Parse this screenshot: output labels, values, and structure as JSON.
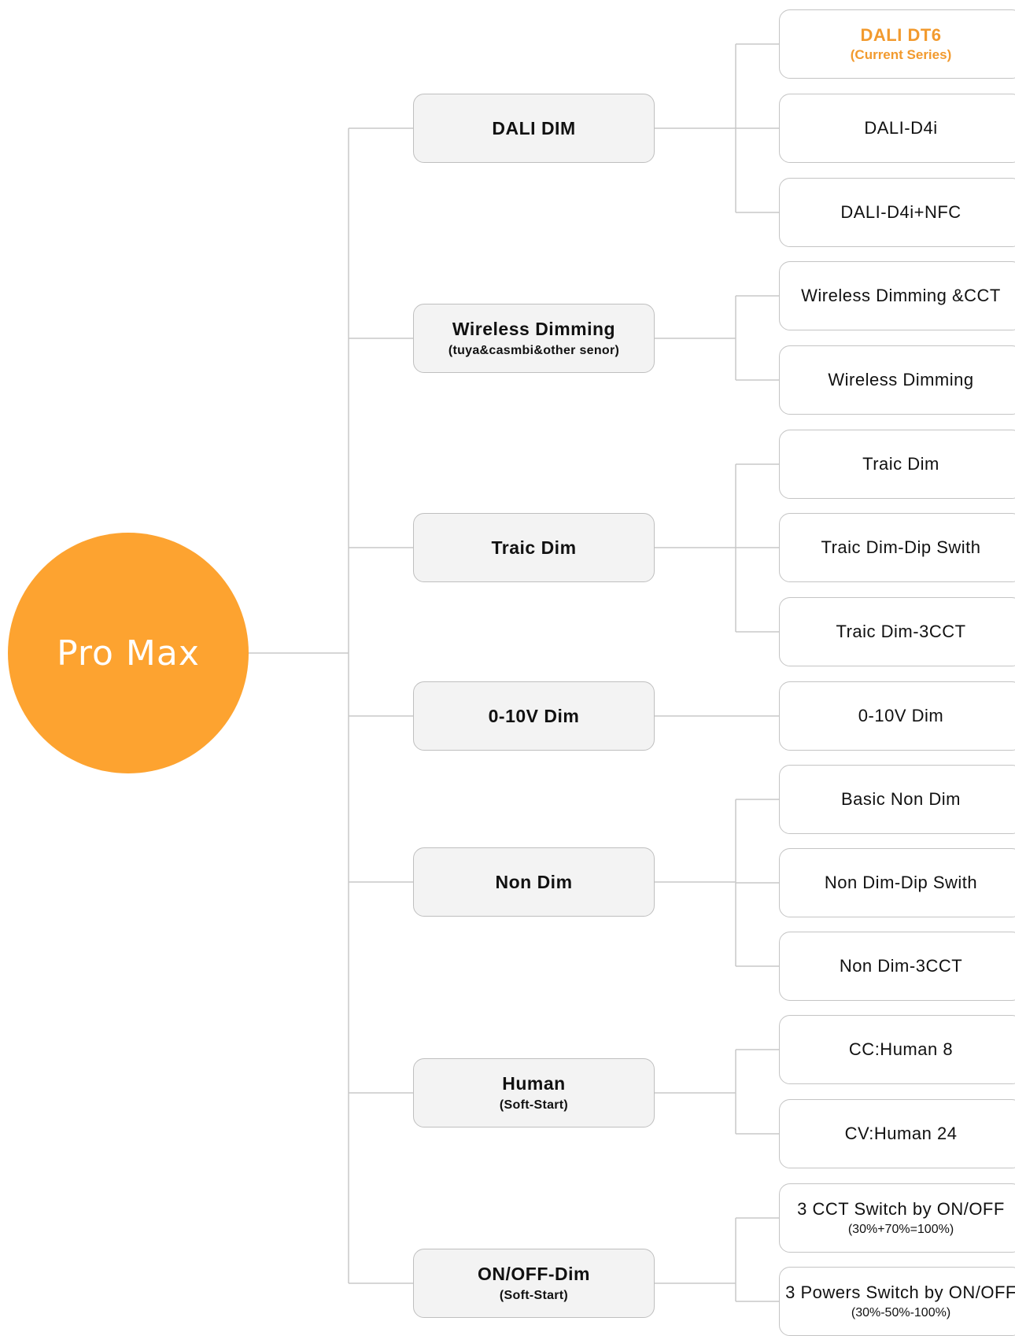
{
  "root": {
    "label": "Pro Max"
  },
  "categories": [
    {
      "title": "DALI DIM",
      "subtitle": "",
      "items": [
        {
          "label": "DALI DT6",
          "sub": "(Current Series)",
          "highlight": true
        },
        {
          "label": "DALI-D4i",
          "sub": ""
        },
        {
          "label": "DALI-D4i+NFC",
          "sub": ""
        }
      ]
    },
    {
      "title": "Wireless Dimming",
      "subtitle": "(tuya&casmbi&other senor)",
      "items": [
        {
          "label": "Wireless Dimming &CCT",
          "sub": ""
        },
        {
          "label": "Wireless Dimming",
          "sub": ""
        }
      ]
    },
    {
      "title": "Traic Dim",
      "subtitle": "",
      "items": [
        {
          "label": "Traic Dim",
          "sub": ""
        },
        {
          "label": "Traic Dim-Dip Swith",
          "sub": ""
        },
        {
          "label": "Traic Dim-3CCT",
          "sub": ""
        }
      ]
    },
    {
      "title": "0-10V Dim",
      "subtitle": "",
      "items": [
        {
          "label": "0-10V Dim",
          "sub": ""
        }
      ]
    },
    {
      "title": "Non Dim",
      "subtitle": "",
      "items": [
        {
          "label": "Basic Non Dim",
          "sub": ""
        },
        {
          "label": "Non Dim-Dip Swith",
          "sub": ""
        },
        {
          "label": "Non Dim-3CCT",
          "sub": ""
        }
      ]
    },
    {
      "title": "Human",
      "subtitle": "(Soft-Start)",
      "items": [
        {
          "label": "CC:Human 8",
          "sub": ""
        },
        {
          "label": "CV:Human 24",
          "sub": ""
        }
      ]
    },
    {
      "title": "ON/OFF-Dim",
      "subtitle": "(Soft-Start)",
      "items": [
        {
          "label": "3 CCT Switch by ON/OFF",
          "sub": "(30%+70%=100%)"
        },
        {
          "label": "3 Powers Switch by ON/OFF",
          "sub": "(30%-50%-100%)"
        }
      ]
    }
  ]
}
